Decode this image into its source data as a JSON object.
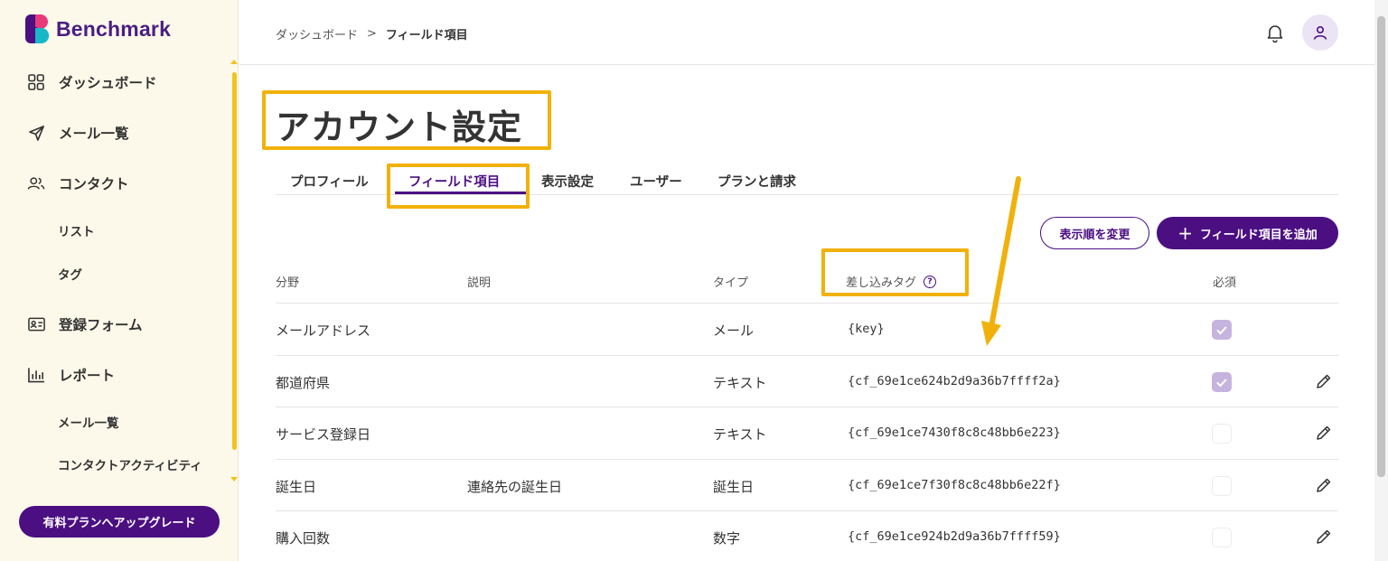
{
  "brand": {
    "name": "Benchmark"
  },
  "sidebar": {
    "items": [
      {
        "label": "ダッシュボード",
        "icon": "dashboard-grid-icon"
      },
      {
        "label": "メール一覧",
        "icon": "paper-plane-icon"
      },
      {
        "label": "コンタクト",
        "icon": "contacts-icon"
      },
      {
        "label": "リスト"
      },
      {
        "label": "タグ"
      },
      {
        "label": "登録フォーム",
        "icon": "id-card-icon"
      },
      {
        "label": "レポート",
        "icon": "bar-chart-icon"
      },
      {
        "label": "メール一覧"
      },
      {
        "label": "コンタクトアクティビティ"
      }
    ],
    "upgrade_label": "有料プランへアップグレード"
  },
  "header": {
    "breadcrumb": {
      "root": "ダッシュボード",
      "separator": ">",
      "current": "フィールド項目"
    }
  },
  "main": {
    "title": "アカウント設定",
    "tabs": [
      {
        "label": "プロフィール"
      },
      {
        "label": "フィールド項目",
        "active": true
      },
      {
        "label": "表示設定"
      },
      {
        "label": "ユーザー"
      },
      {
        "label": "プランと請求"
      }
    ],
    "buttons": {
      "reorder": "表示順を変更",
      "add_plus": "+",
      "add": "フィールド項目を追加"
    },
    "table": {
      "columns": [
        "分野",
        "説明",
        "タイプ",
        "差し込みタグ",
        "必須"
      ],
      "help_icon_glyph": "?",
      "rows": [
        {
          "field": "メールアドレス",
          "description": "",
          "type": "メール",
          "tag": "{key}",
          "required": true,
          "editable": false
        },
        {
          "field": "都道府県",
          "description": "",
          "type": "テキスト",
          "tag": "{cf_69e1ce624b2d9a36b7ffff2a}",
          "required": true,
          "editable": true
        },
        {
          "field": "サービス登録日",
          "description": "",
          "type": "テキスト",
          "tag": "{cf_69e1ce7430f8c8c48bb6e223}",
          "required": false,
          "editable": true
        },
        {
          "field": "誕生日",
          "description": "連絡先の誕生日",
          "type": "誕生日",
          "tag": "{cf_69e1ce7f30f8c8c48bb6e22f}",
          "required": false,
          "editable": true
        },
        {
          "field": "購入回数",
          "description": "",
          "type": "数字",
          "tag": "{cf_69e1ce924b2d9a36b7ffff59}",
          "required": false,
          "editable": true
        }
      ]
    }
  },
  "colors": {
    "brand_purple": "#4b0f82",
    "sidebar_bg": "#fdf9ea",
    "highlight_yellow": "#f2b10a",
    "checkbox_checked": "#c6b4de"
  }
}
